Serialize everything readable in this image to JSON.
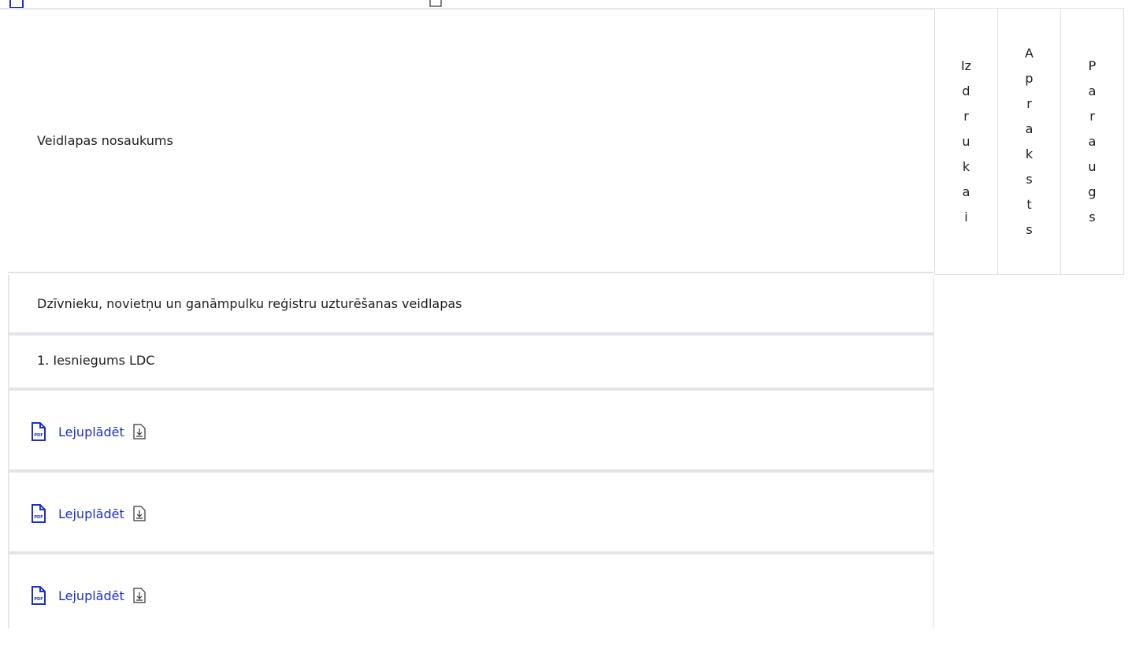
{
  "table": {
    "header": {
      "name_column": "Veidlapas nosaukums",
      "vertical_columns": [
        "Izdrukai",
        "Apraksts",
        "Paraugs"
      ]
    },
    "section": {
      "title": "Dzīvnieku, novietņu un ganāmpulku reģistru uzturēšanas veidlapas"
    },
    "form": {
      "title": "1. Iesniegums LDC"
    },
    "files": [
      {
        "label": "Lejuplādēt",
        "file_icon": "pdf-icon",
        "download_icon": "download-icon"
      },
      {
        "label": "Lejuplādēt",
        "file_icon": "pdf-icon",
        "download_icon": "download-icon"
      },
      {
        "label": "Lejuplādēt",
        "file_icon": "pdf-icon",
        "download_icon": "download-icon"
      }
    ],
    "pdf_badge": "PDF"
  },
  "colors": {
    "link": "#1b2fc9",
    "border": "#e2e4ea",
    "text": "#1f1f24"
  }
}
